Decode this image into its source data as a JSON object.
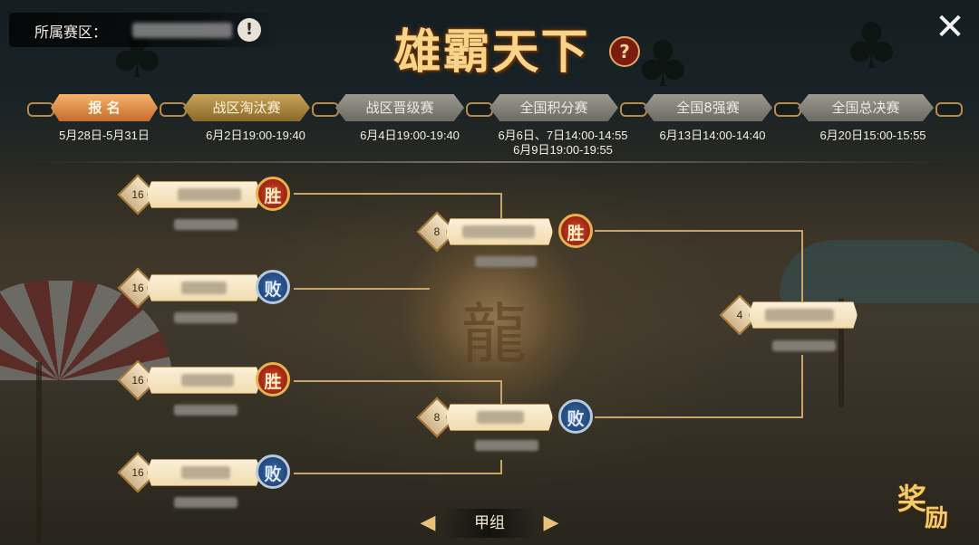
{
  "header": {
    "zone_label": "所属赛区：",
    "title": "雄霸天下",
    "close_glyph": "✕",
    "help_glyph": "?",
    "info_glyph": "!"
  },
  "stages": [
    {
      "label": "报 名",
      "date": "5月28日-5月31日",
      "state": "active"
    },
    {
      "label": "战区淘汰赛",
      "date": "6月2日19:00-19:40",
      "state": "current"
    },
    {
      "label": "战区晋级赛",
      "date": "6月4日19:00-19:40",
      "state": "inactive"
    },
    {
      "label": "全国积分赛",
      "date": "6月6日、7日14:00-14:55",
      "date2": "6月9日19:00-19:55",
      "state": "inactive"
    },
    {
      "label": "全国8强赛",
      "date": "6月13日14:00-14:40",
      "state": "inactive"
    },
    {
      "label": "全国总决赛",
      "date": "6月20日15:00-15:55",
      "state": "inactive"
    }
  ],
  "bracket": {
    "round16": [
      {
        "seed": "16",
        "result": "胜",
        "outcome": "win"
      },
      {
        "seed": "16",
        "result": "败",
        "outcome": "lose"
      },
      {
        "seed": "16",
        "result": "胜",
        "outcome": "win"
      },
      {
        "seed": "16",
        "result": "败",
        "outcome": "lose"
      }
    ],
    "round8": [
      {
        "seed": "8",
        "result": "胜",
        "outcome": "win"
      },
      {
        "seed": "8",
        "result": "败",
        "outcome": "lose"
      }
    ],
    "round4": [
      {
        "seed": "4"
      }
    ]
  },
  "footer": {
    "group_label": "甲组",
    "prev_glyph": "◀",
    "next_glyph": "▶",
    "reward_char1": "奖",
    "reward_char2": "励"
  },
  "colors": {
    "win": "#c8321a",
    "lose": "#2a5a94",
    "gold": "#c9a46a"
  }
}
